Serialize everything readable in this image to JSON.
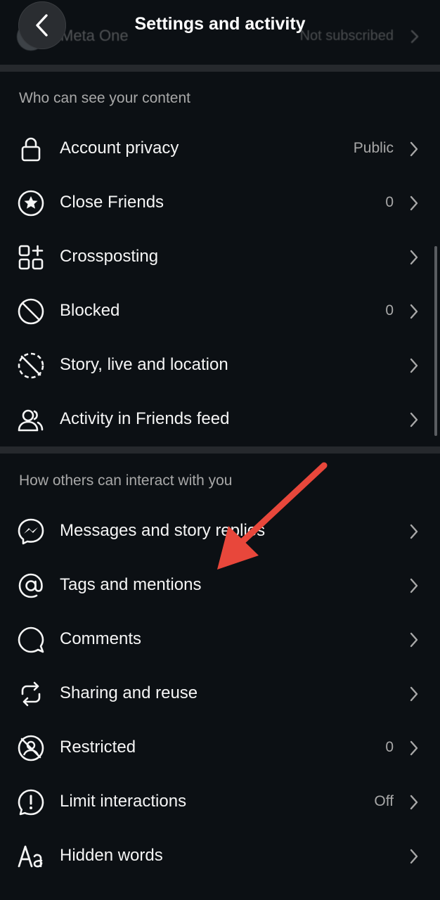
{
  "header": {
    "title": "Settings and activity",
    "meta_row": {
      "label": "Meta One",
      "status": "Not subscribed"
    }
  },
  "sections": [
    {
      "title": "Who can see your content",
      "items": [
        {
          "label": "Account privacy",
          "value": "Public",
          "icon": "lock-icon"
        },
        {
          "label": "Close Friends",
          "value": "0",
          "icon": "star-circle-icon"
        },
        {
          "label": "Crossposting",
          "value": "",
          "icon": "grid-plus-icon"
        },
        {
          "label": "Blocked",
          "value": "0",
          "icon": "blocked-icon"
        },
        {
          "label": "Story, live and location",
          "value": "",
          "icon": "story-hide-icon"
        },
        {
          "label": "Activity in Friends feed",
          "value": "",
          "icon": "friends-icon"
        }
      ]
    },
    {
      "title": "How others can interact with you",
      "items": [
        {
          "label": "Messages and story replies",
          "value": "",
          "icon": "messenger-icon"
        },
        {
          "label": "Tags and mentions",
          "value": "",
          "icon": "at-icon"
        },
        {
          "label": "Comments",
          "value": "",
          "icon": "comment-icon"
        },
        {
          "label": "Sharing and reuse",
          "value": "",
          "icon": "repost-icon"
        },
        {
          "label": "Restricted",
          "value": "0",
          "icon": "restricted-icon"
        },
        {
          "label": "Limit interactions",
          "value": "Off",
          "icon": "alert-circle-icon"
        },
        {
          "label": "Hidden words",
          "value": "",
          "icon": "text-aa-icon"
        }
      ]
    }
  ],
  "colors": {
    "background": "#0c1014",
    "divider": "#26292d",
    "annotation_arrow": "#e8473b"
  }
}
